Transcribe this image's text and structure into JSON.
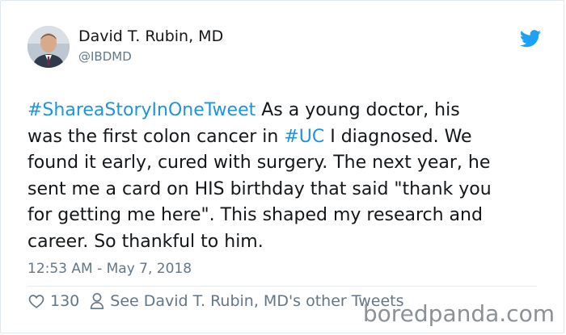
{
  "author": {
    "name": "David T. Rubin, MD",
    "handle": "@IBDMD"
  },
  "tweet": {
    "hashtag_1": "#ShareaStoryInOneTweet",
    "text_1": " As a young doctor, his\nwas the first colon cancer in ",
    "hashtag_2": "#UC",
    "text_2": " I diagnosed. We\nfound it early, cured with surgery. The next year, he\nsent me a card on HIS birthday that said \"thank you\nfor getting me here\". This shaped my research and\ncareer. So thankful to him.",
    "timestamp": "12:53 AM - May 7, 2018"
  },
  "actions": {
    "like_count": "130",
    "other_tweets_label": "See David T. Rubin, MD's other Tweets"
  },
  "icons": {
    "brand": "twitter-bird-icon",
    "like": "heart-icon",
    "profile": "person-icon"
  },
  "colors": {
    "link": "#1b95e0",
    "twitter_blue": "#1da1f2",
    "muted": "#657786"
  },
  "watermark": "boredpanda.com"
}
